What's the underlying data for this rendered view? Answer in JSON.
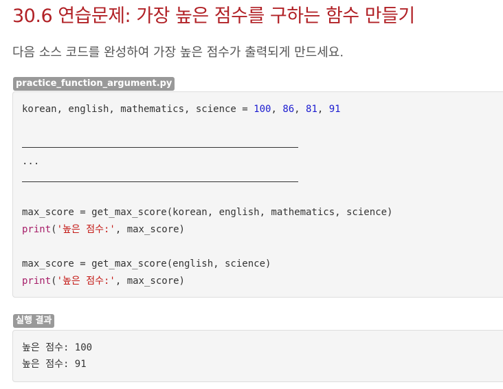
{
  "page": {
    "title": "30.6 연습문제: 가장 높은 점수를 구하는 함수 만들기",
    "description": "다음 소스 코드를 완성하여 가장 높은 점수가 출력되게 만드세요."
  },
  "code_block": {
    "filename": "practice_function_argument.py",
    "line1": {
      "vars": "korean, english, mathematics, science = ",
      "v1": "100",
      "sep1": ", ",
      "v2": "86",
      "sep2": ", ",
      "v3": "81",
      "sep3": ", ",
      "v4": "91"
    },
    "ellipsis": "...",
    "line_call1": "max_score = get_max_score(korean, english, mathematics, science)",
    "print1": {
      "kw": "print",
      "open": "(",
      "str": "'높은 점수:'",
      "rest": ", max_score)"
    },
    "line_call2": "max_score = get_max_score(english, science)",
    "print2": {
      "kw": "print",
      "open": "(",
      "str": "'높은 점수:'",
      "rest": ", max_score)"
    }
  },
  "result": {
    "label": "실행 결과",
    "lines": [
      "높은 점수: 100",
      "높은 점수: 91"
    ]
  },
  "colors": {
    "title": "#b12126",
    "number": "#1b1bd0",
    "keyword": "#a61d68",
    "string": "#c41a16",
    "label_bg": "#999999",
    "code_bg": "#f5f5f5"
  }
}
